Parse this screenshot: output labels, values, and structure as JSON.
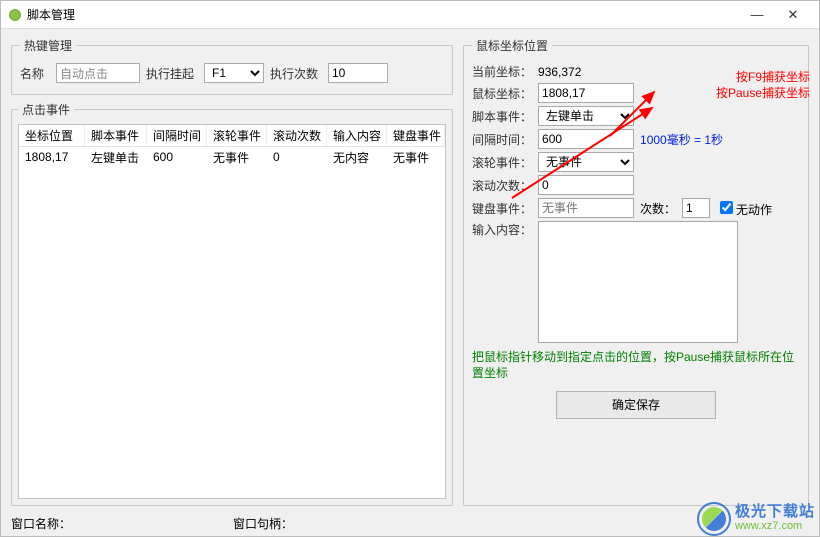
{
  "window": {
    "title": "脚本管理",
    "minimize": "—",
    "close": "✕"
  },
  "hotkey": {
    "legend": "热键管理",
    "name_label": "名称",
    "name_value": "自动点击",
    "suspend_label": "执行挂起",
    "suspend_value": "F1",
    "times_label": "执行次数",
    "times_value": "10"
  },
  "clickEvents": {
    "legend": "点击事件",
    "headers": [
      "坐标位置",
      "脚本事件",
      "间隔时间",
      "滚轮事件",
      "滚动次数",
      "输入内容",
      "键盘事件"
    ],
    "rows": [
      [
        "1808,17",
        "左键单击",
        "600",
        "无事件",
        "0",
        "无内容",
        "无事件"
      ]
    ]
  },
  "mouse": {
    "legend": "鼠标坐标位置",
    "current_label": "当前坐标：",
    "current_value": "936,372",
    "pos_label": "鼠标坐标：",
    "pos_value": "1808,17",
    "capture_hint_f9": "按F9捕获坐标",
    "capture_hint_pause": "按Pause捕获坐标",
    "script_evt_label": "脚本事件：",
    "script_evt_value": "左键单击",
    "interval_label": "间隔时间：",
    "interval_value": "600",
    "interval_hint": "1000毫秒 = 1秒",
    "wheel_evt_label": "滚轮事件：",
    "wheel_evt_value": "无事件",
    "scroll_times_label": "滚动次数：",
    "scroll_times_value": "0",
    "keyboard_label": "键盘事件：",
    "keyboard_placeholder": "无事件",
    "keyboard_times_label": "次数：",
    "keyboard_times_value": "1",
    "noaction_label": "无动作",
    "input_label": "输入内容：",
    "tip": "把鼠标指针移动到指定点击的位置，按Pause捕获鼠标所在位置坐标",
    "save_btn": "确定保存"
  },
  "footer": {
    "winname_label": "窗口名称：",
    "winhandle_label": "窗口句柄："
  },
  "watermark": {
    "cn": "极光下载站",
    "url": "www.xz7.com"
  }
}
